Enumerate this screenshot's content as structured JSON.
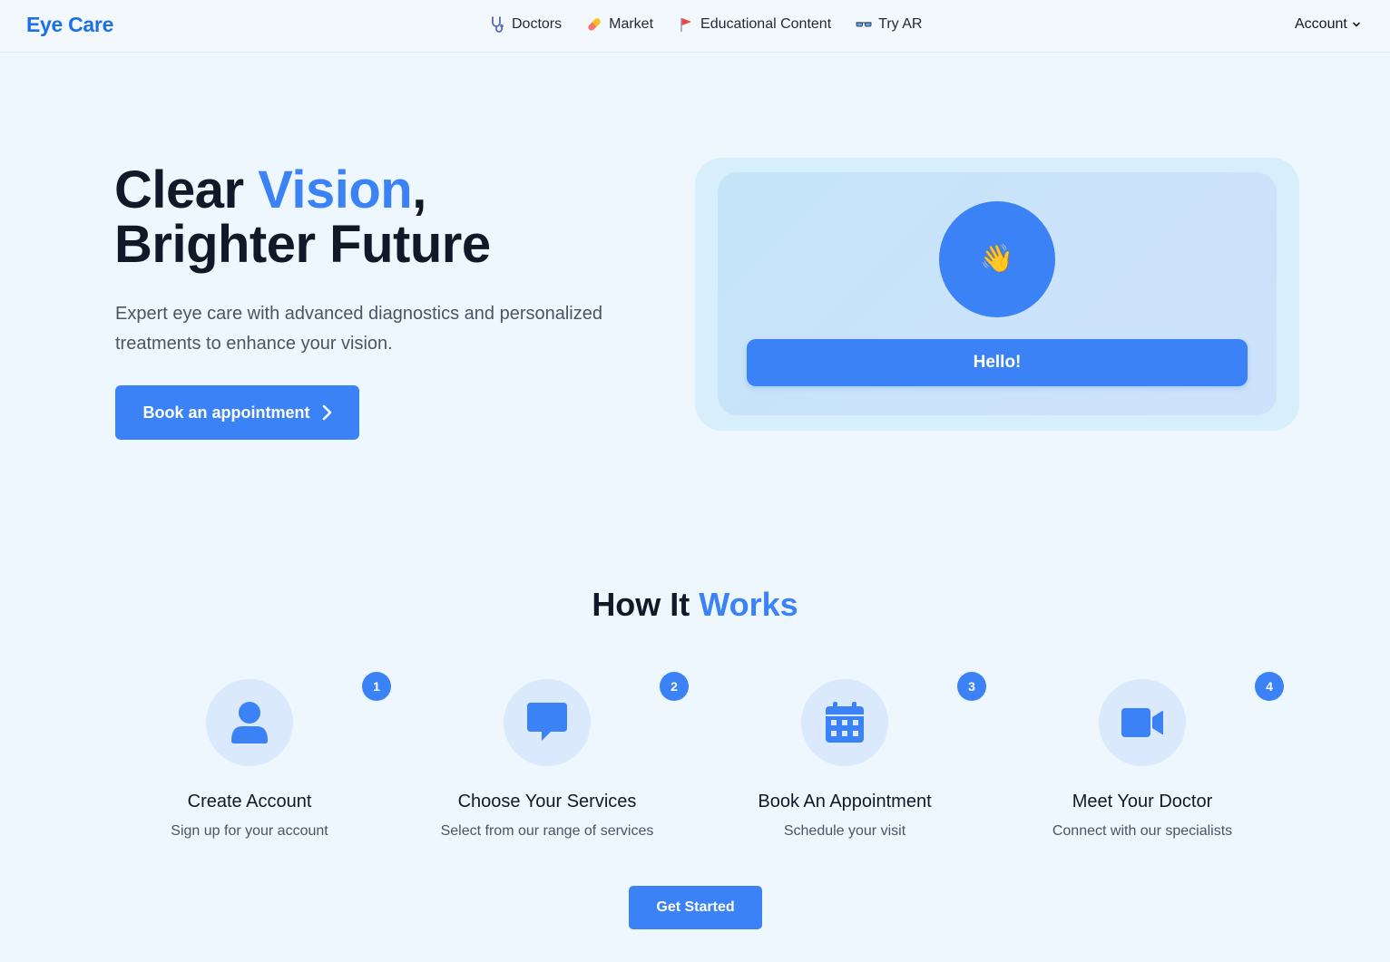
{
  "nav": {
    "brand": "Eye Care",
    "links": [
      {
        "label": "Doctors",
        "icon": "stethoscope-icon"
      },
      {
        "label": "Market",
        "icon": "pill-icon"
      },
      {
        "label": "Educational Content",
        "icon": "flag-icon"
      },
      {
        "label": "Try AR",
        "icon": "glasses-icon"
      }
    ],
    "account_label": "Account"
  },
  "hero": {
    "title_part1": "Clear ",
    "title_accent": "Vision",
    "title_part2": ",",
    "title_line2": "Brighter Future",
    "subtitle": "Expert eye care with advanced diagnostics and personalized treatments to enhance your vision.",
    "cta_label": "Book an appointment",
    "card": {
      "emoji": "👋",
      "button_label": "Hello!"
    }
  },
  "how": {
    "title_part1": "How It ",
    "title_accent": "Works",
    "steps": [
      {
        "number": "1",
        "title": "Create Account",
        "description": "Sign up for your account",
        "icon": "user-icon"
      },
      {
        "number": "2",
        "title": "Choose Your Services",
        "description": "Select from our range of services",
        "icon": "chat-icon"
      },
      {
        "number": "3",
        "title": "Book An Appointment",
        "description": "Schedule your visit",
        "icon": "calendar-icon"
      },
      {
        "number": "4",
        "title": "Meet Your Doctor",
        "description": "Connect with our specialists",
        "icon": "video-icon"
      }
    ],
    "cta_label": "Get Started"
  },
  "colors": {
    "accent": "#3b82f6",
    "brand": "#1d6fe8",
    "background": "#eef7fd"
  }
}
